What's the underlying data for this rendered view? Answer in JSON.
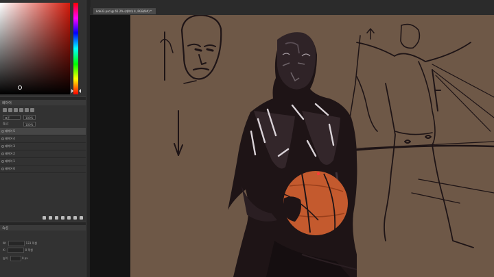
{
  "document": {
    "tab_title": "kde33.psd @ 65.2% (레이어 4, RGB/8#) *"
  },
  "colors": {
    "foreground": "#d31b0c",
    "canvas_background": "#6e5847",
    "basketball": "#c45a2e",
    "figure_shadow": "#1e1416"
  },
  "layers_panel": {
    "tab_label": "레이어",
    "blend_mode": "표준",
    "opacity": "100%",
    "lock_label": "잠금:",
    "fill": "100%",
    "layers": [
      {
        "name": "레이어 5"
      },
      {
        "name": "레이어 4"
      },
      {
        "name": "레이어 3"
      },
      {
        "name": "레이어 2"
      },
      {
        "name": "레이어 1"
      },
      {
        "name": "레이어 0"
      }
    ]
  },
  "properties_panel": {
    "tab_label": "속성",
    "row1_label": "W:",
    "row1_value": "133 픽셀",
    "row2_label": "X:",
    "row2_value": "0 픽셀",
    "row3_label": "높이",
    "row3_value": "0 px"
  }
}
